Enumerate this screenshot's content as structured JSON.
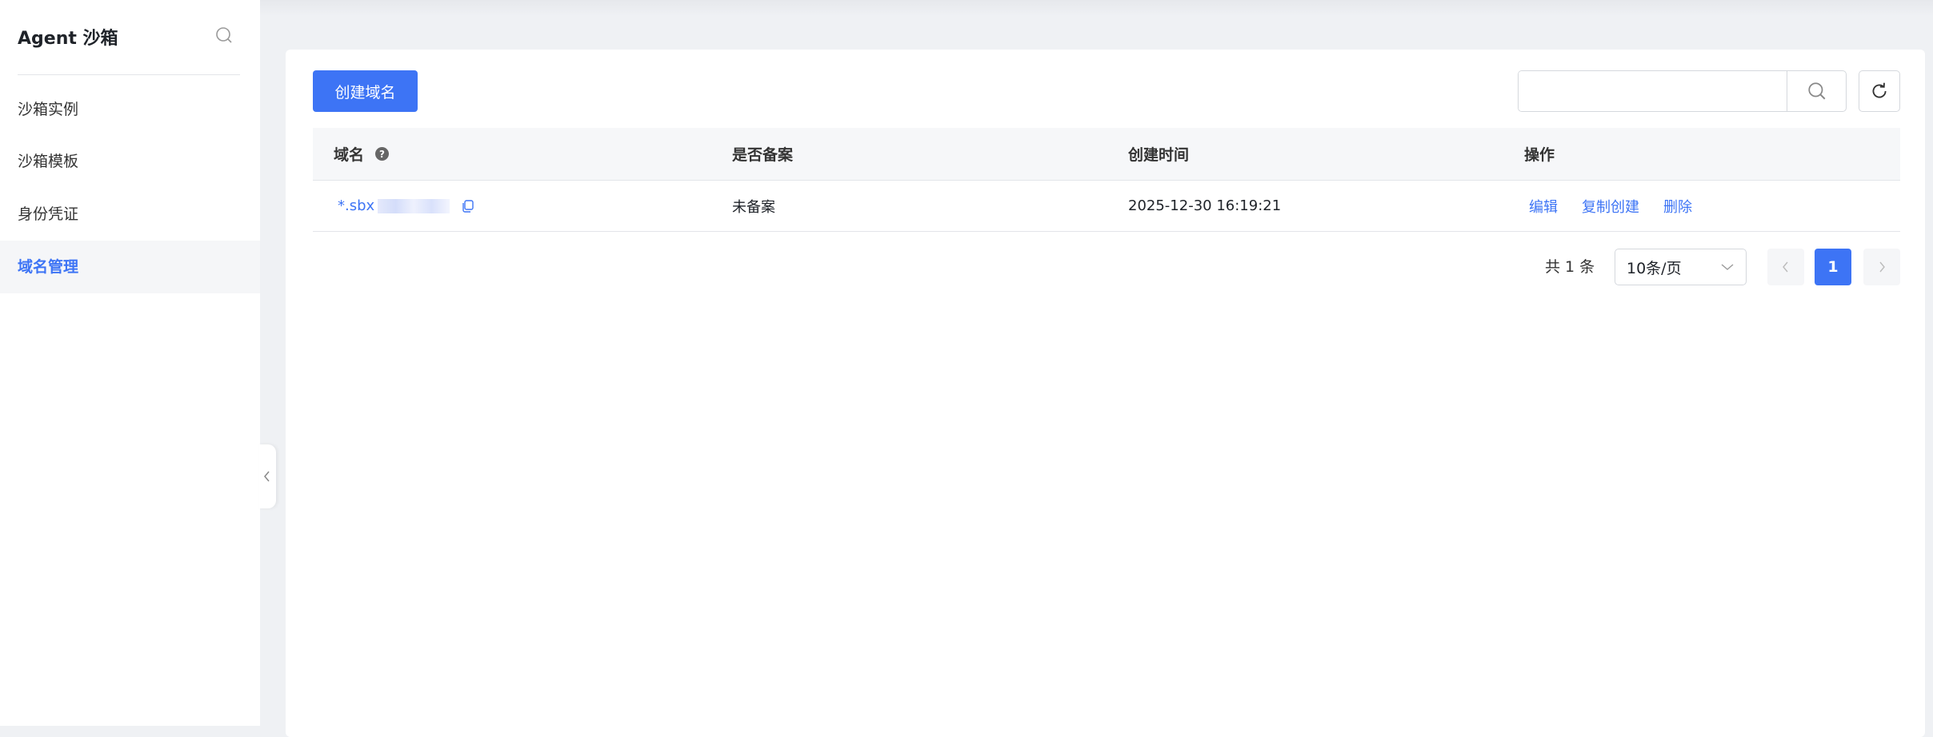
{
  "sidebar": {
    "title": "Agent 沙箱",
    "items": [
      {
        "label": "沙箱实例"
      },
      {
        "label": "沙箱模板"
      },
      {
        "label": "身份凭证"
      },
      {
        "label": "域名管理",
        "active": true
      }
    ]
  },
  "toolbar": {
    "create_label": "创建域名",
    "search_placeholder": "",
    "search_value": ""
  },
  "table": {
    "columns": [
      "域名",
      "是否备案",
      "创建时间",
      "操作"
    ],
    "rows": [
      {
        "domain": "*.sbx",
        "filing": "未备案",
        "created": "2025-12-30 16:19:21",
        "actions": [
          "编辑",
          "复制创建",
          "删除"
        ]
      }
    ]
  },
  "pagination": {
    "total_text": "共 1 条",
    "page_size": "10条/页",
    "current_page": "1"
  },
  "colors": {
    "accent": "#3d74f5"
  }
}
